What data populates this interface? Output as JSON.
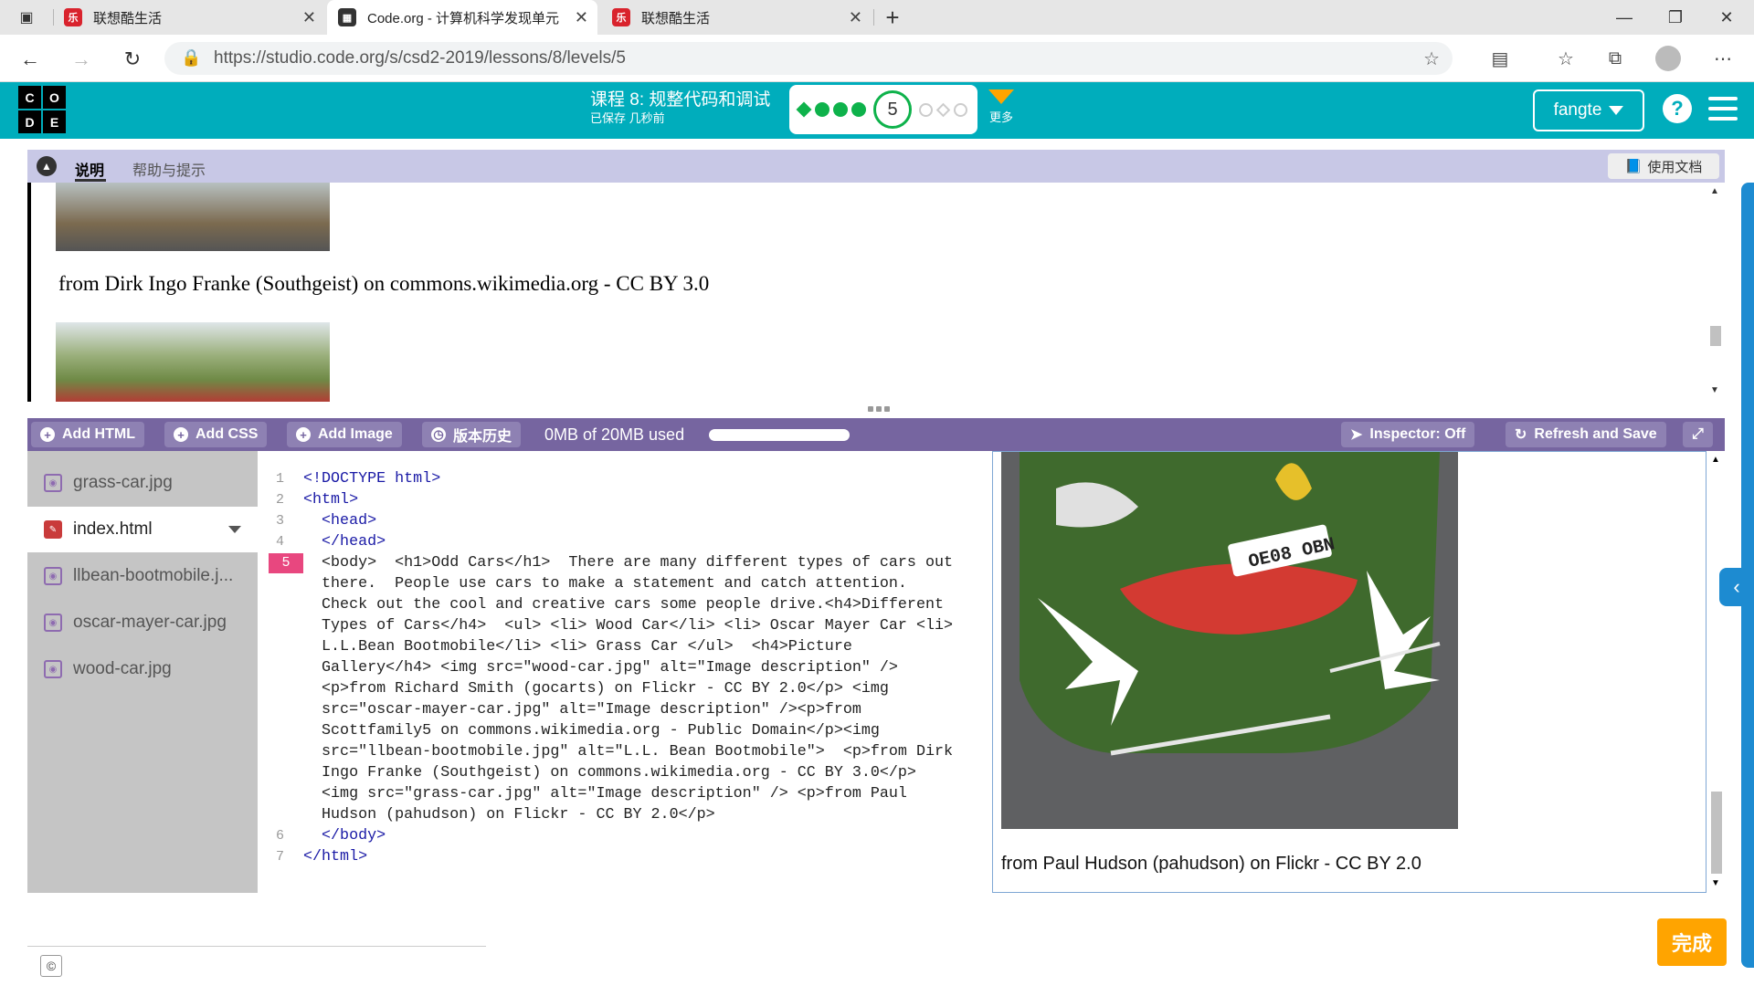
{
  "browser": {
    "tabs": [
      {
        "label": "联想酷生活",
        "favicon": "lenovo-icon"
      },
      {
        "label": "Code.org - 计算机科学发现单元",
        "favicon": "codeorg-icon"
      },
      {
        "label": "联想酷生活",
        "favicon": "lenovo-icon"
      }
    ],
    "url": "https://studio.code.org/s/csd2-2019/lessons/8/levels/5"
  },
  "header": {
    "logo_letters": [
      "C",
      "O",
      "D",
      "E"
    ],
    "lesson_title": "课程 8: 规整代码和调试",
    "saved_status": "已保存 几秒前",
    "current_level": "5",
    "more_label": "更多",
    "user_name": "fangte",
    "help_label": "?"
  },
  "instructions": {
    "tabs": [
      "说明",
      "帮助与提示"
    ],
    "doc_button": "使用文档",
    "caption": "from Dirk Ingo Franke (Southgeist) on commons.wikimedia.org - CC BY 3.0"
  },
  "toolbar": {
    "add_html": "Add HTML",
    "add_css": "Add CSS",
    "add_image": "Add Image",
    "history": "版本历史",
    "usage": "0MB of 20MB used",
    "inspector": "Inspector: Off",
    "refresh": "Refresh and Save"
  },
  "files": [
    "grass-car.jpg",
    "index.html",
    "llbean-bootmobile.j...",
    "oscar-mayer-car.jpg",
    "wood-car.jpg"
  ],
  "editor": {
    "line_numbers": [
      "1",
      "2",
      "3",
      "4",
      "5",
      "6",
      "7"
    ],
    "lines": [
      "<!DOCTYPE html>",
      "<html>",
      "  <head>",
      "  </head>",
      "  <body>  <h1>Odd Cars</h1>  There are many different types of cars out",
      "  there.  People use cars to make a statement and catch attention.",
      "  Check out the cool and creative cars some people drive.<h4>Different",
      "  Types of Cars</h4>  <ul> <li> Wood Car</li> <li> Oscar Mayer Car <li>",
      "  L.L.Bean Bootmobile</li> <li> Grass Car </ul>  <h4>Picture",
      "  Gallery</h4> <img src=\"wood-car.jpg\" alt=\"Image description\" />",
      "  <p>from Richard Smith (gocarts) on Flickr - CC BY 2.0</p> <img",
      "  src=\"oscar-mayer-car.jpg\" alt=\"Image description\" /><p>from",
      "  Scottfamily5 on commons.wikimedia.org - Public Domain</p><img",
      "  src=\"llbean-bootmobile.jpg\" alt=\"L.L. Bean Bootmobile\">  <p>from Dirk",
      "  Ingo Franke (Southgeist) on commons.wikimedia.org - CC BY 3.0</p>",
      "  <img src=\"grass-car.jpg\" alt=\"Image description\" /> <p>from Paul",
      "  Hudson (pahudson) on Flickr - CC BY 2.0</p>",
      "  </body>",
      "</html>"
    ]
  },
  "preview": {
    "plate": "OE08 OBN",
    "caption": "from Paul Hudson (pahudson) on Flickr - CC BY 2.0"
  },
  "footer": {
    "copyright": "©",
    "finish": "完成"
  },
  "colors": {
    "header_teal": "#00adbc",
    "toolbar_purple": "#7665a0",
    "progress_green": "#0eb24b",
    "finish_orange": "#ffa400"
  }
}
